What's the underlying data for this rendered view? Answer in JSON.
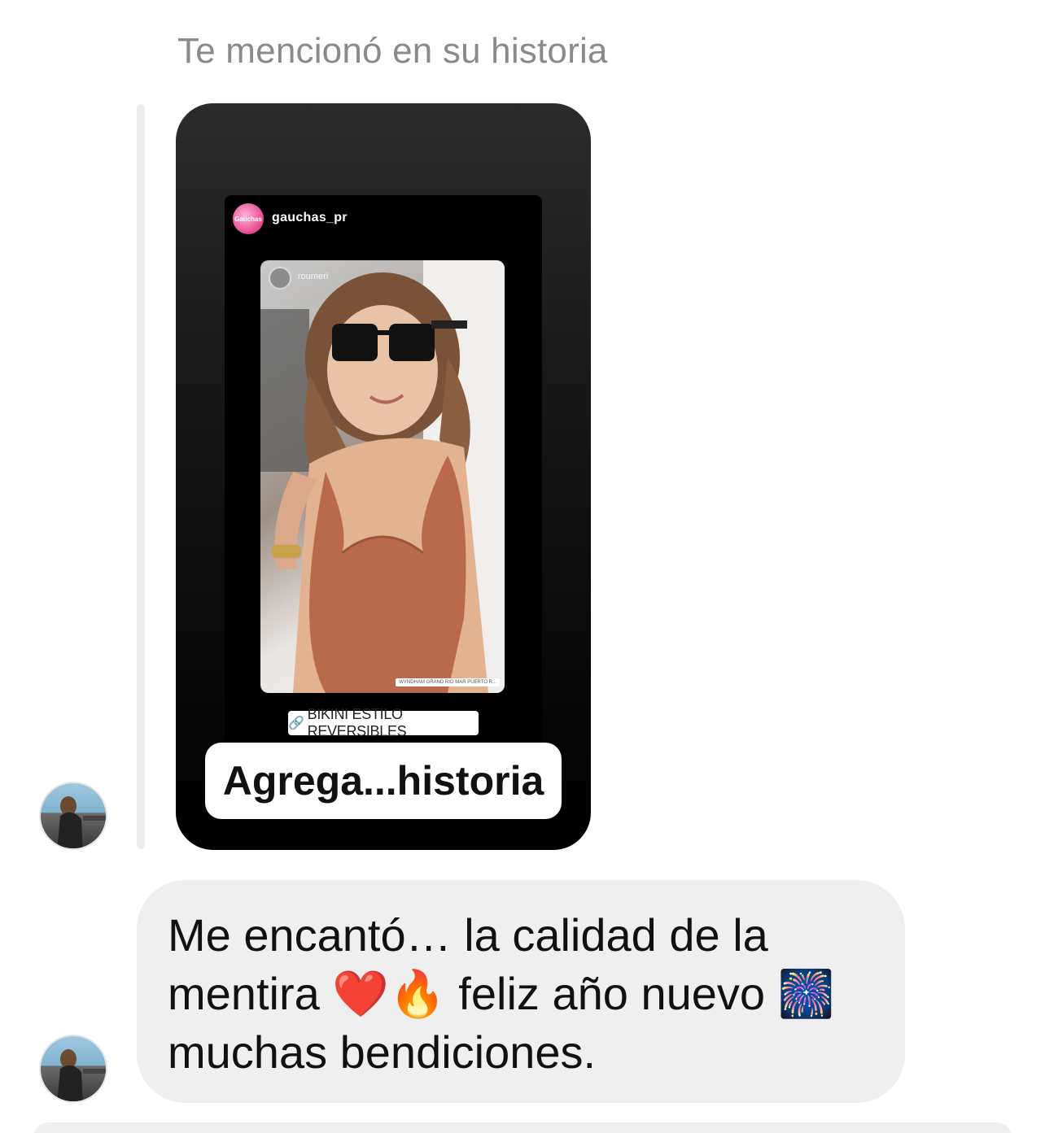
{
  "mention_label": "Te mencionó en su historia",
  "story": {
    "username": "gauchas_pr",
    "avatar_text": "Gauchas",
    "photo_username": "roumeri",
    "location_text": "WYNDHAM GRAND RIO MAR PUERTO R...",
    "link_sticker": "BIKINI ESTILO REVERSIBLES",
    "add_to_story_button": "Agrega...historia"
  },
  "message": {
    "text": "Me encantó… la calidad de la mentira ❤️🔥 feliz año nuevo 🎆 muchas bendiciones."
  },
  "icons": {
    "link": "link-icon",
    "sender_avatar": "avatar"
  },
  "colors": {
    "bubble": "#efefef",
    "label": "#8a8a8a",
    "card_bg": "#141414"
  }
}
